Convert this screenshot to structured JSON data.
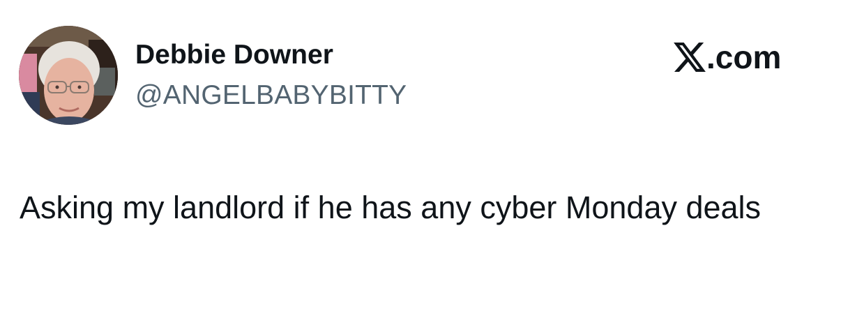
{
  "author": {
    "display_name": "Debbie Downer",
    "handle": "@ANGELBABYBITTY",
    "avatar_icon": "profile-photo"
  },
  "brand": {
    "logo_icon": "x-logo-icon",
    "text": ".com"
  },
  "tweet": {
    "text": "Asking my landlord if he has any cyber Monday deals"
  },
  "colors": {
    "text_primary": "#0f1419",
    "text_secondary": "#536471",
    "background": "#ffffff"
  }
}
